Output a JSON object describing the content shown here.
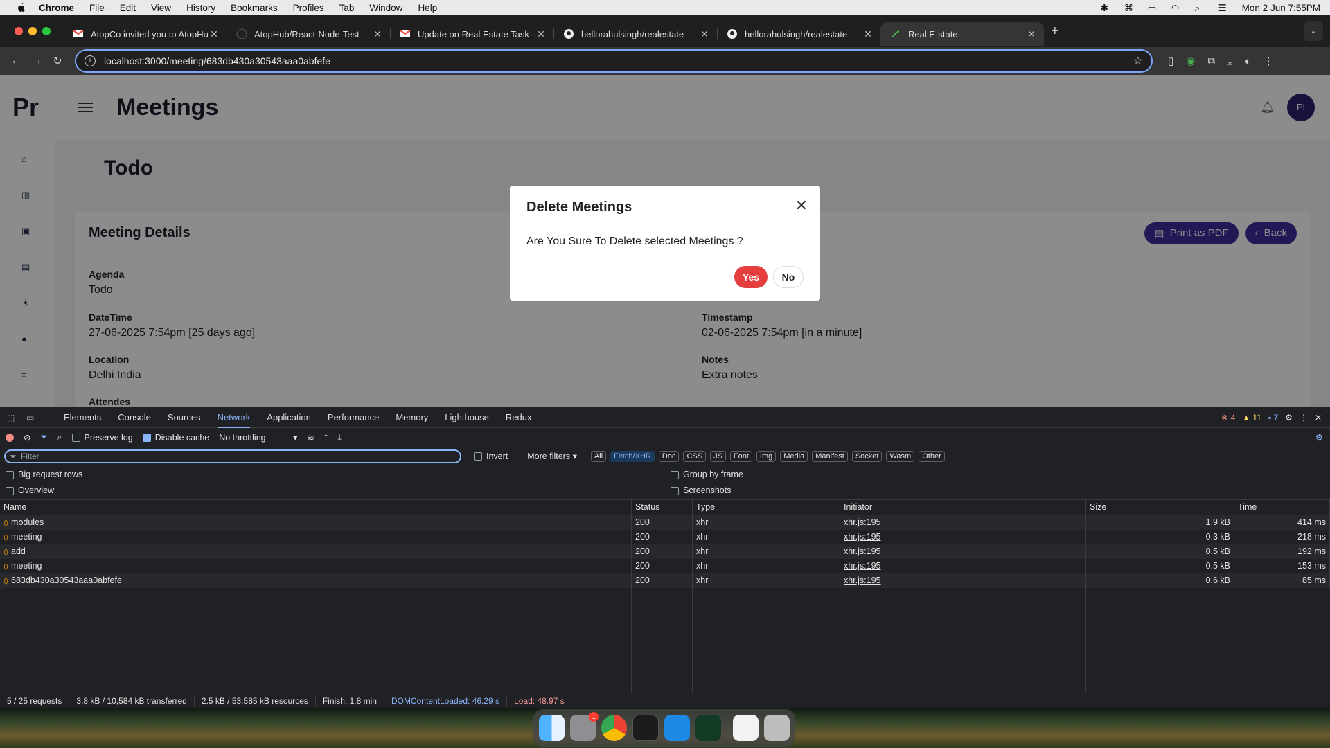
{
  "menubar": {
    "app": "Chrome",
    "items": [
      "File",
      "Edit",
      "View",
      "History",
      "Bookmarks",
      "Profiles",
      "Tab",
      "Window",
      "Help"
    ],
    "datetime": "Mon 2 Jun  7:55PM"
  },
  "tabs": [
    {
      "title": "AtopCo invited you to AtopHu",
      "icon": "gmail-icon"
    },
    {
      "title": "AtopHub/React-Node-Test",
      "icon": "github-icon"
    },
    {
      "title": "Update on Real Estate Task -",
      "icon": "gmail-icon"
    },
    {
      "title": "hellorahulsingh/realestate",
      "icon": "github-icon"
    },
    {
      "title": "hellorahulsingh/realestate",
      "icon": "github-icon"
    },
    {
      "title": "Real E-state",
      "icon": "app-icon",
      "active": true
    }
  ],
  "omnibox": {
    "url": "localhost:3000/meeting/683db430a30543aaa0abfefe"
  },
  "app": {
    "logo": "Pr",
    "page_title": "Meetings",
    "avatar": "PI",
    "sub_title": "Todo",
    "card_title": "Meeting Details",
    "print_label": "Print as PDF",
    "back_label": "Back",
    "fields": {
      "agenda_label": "Agenda",
      "agenda": "Todo",
      "datetime_label": "DateTime",
      "datetime": "27-06-2025 7:54pm [25 days ago]",
      "timestamp_label": "Timestamp",
      "timestamp": "02-06-2025 7:54pm [in a minute]",
      "location_label": "Location",
      "location": "Delhi India",
      "notes_label": "Notes",
      "notes": "Extra notes",
      "attendes_label": "Attendes",
      "attendes": "-"
    }
  },
  "modal": {
    "title": "Delete Meetings",
    "body": "Are You Sure To Delete selected Meetings ?",
    "yes": "Yes",
    "no": "No"
  },
  "devtools": {
    "tabs": [
      "Elements",
      "Console",
      "Sources",
      "Network",
      "Application",
      "Performance",
      "Memory",
      "Lighthouse",
      "Redux"
    ],
    "active_tab": "Network",
    "counts": {
      "errors": "4",
      "warnings": "11",
      "messages": "7"
    },
    "preserve_log": "Preserve log",
    "disable_cache": "Disable cache",
    "throttling": "No throttling",
    "filter_placeholder": "Filter",
    "invert": "Invert",
    "more_filters": "More filters",
    "type_filters": [
      "All",
      "Fetch/XHR",
      "Doc",
      "CSS",
      "JS",
      "Font",
      "Img",
      "Media",
      "Manifest",
      "Socket",
      "Wasm",
      "Other"
    ],
    "selected_filter": "Fetch/XHR",
    "options": {
      "big_rows": "Big request rows",
      "overview": "Overview",
      "group_frame": "Group by frame",
      "screenshots": "Screenshots"
    },
    "columns": {
      "name": "Name",
      "status": "Status",
      "type": "Type",
      "initiator": "Initiator",
      "size": "Size",
      "time": "Time"
    },
    "rows": [
      {
        "name": "modules",
        "status": "200",
        "type": "xhr",
        "initiator": "xhr.js:195",
        "size": "1.9 kB",
        "time": "414 ms"
      },
      {
        "name": "meeting",
        "status": "200",
        "type": "xhr",
        "initiator": "xhr.js:195",
        "size": "0.3 kB",
        "time": "218 ms"
      },
      {
        "name": "add",
        "status": "200",
        "type": "xhr",
        "initiator": "xhr.js:195",
        "size": "0.5 kB",
        "time": "192 ms"
      },
      {
        "name": "meeting",
        "status": "200",
        "type": "xhr",
        "initiator": "xhr.js:195",
        "size": "0.5 kB",
        "time": "153 ms"
      },
      {
        "name": "683db430a30543aaa0abfefe",
        "status": "200",
        "type": "xhr",
        "initiator": "xhr.js:195",
        "size": "0.6 kB",
        "time": "85 ms"
      }
    ],
    "summary": {
      "requests": "5 / 25 requests",
      "transferred": "3.8 kB / 10,584 kB transferred",
      "resources": "2.5 kB / 53,585 kB resources",
      "finish": "Finish: 1.8 min",
      "dcl": "DOMContentLoaded: 46.29 s",
      "load": "Load: 48.97 s"
    }
  },
  "dock": {
    "chrome_badge": "1"
  },
  "colors": {
    "accent": "#3d2d9c",
    "danger": "#e53e3e",
    "devtools_blue": "#8ab4f8"
  }
}
